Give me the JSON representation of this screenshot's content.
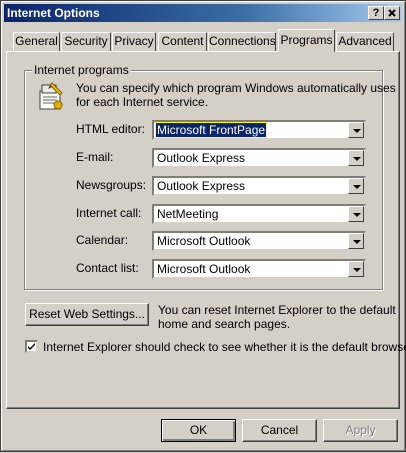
{
  "window": {
    "title": "Internet Options",
    "help_button": "?",
    "close_button": "X"
  },
  "tabs": [
    {
      "label": "General"
    },
    {
      "label": "Security"
    },
    {
      "label": "Privacy"
    },
    {
      "label": "Content"
    },
    {
      "label": "Connections"
    },
    {
      "label": "Programs",
      "active": true
    },
    {
      "label": "Advanced"
    }
  ],
  "programs": {
    "group_label": "Internet programs",
    "description_line1": "You can specify which program Windows automatically uses",
    "description_line2": "for each Internet service.",
    "icon": "programs-icon",
    "rows": [
      {
        "label": "HTML editor:",
        "value": "Microsoft FrontPage"
      },
      {
        "label": "E-mail:",
        "value": "Outlook Express"
      },
      {
        "label": "Newsgroups:",
        "value": "Outlook Express"
      },
      {
        "label": "Internet call:",
        "value": "NetMeeting"
      },
      {
        "label": "Calendar:",
        "value": "Microsoft Outlook"
      },
      {
        "label": "Contact list:",
        "value": "Microsoft Outlook"
      }
    ]
  },
  "reset": {
    "button_label": "Reset Web Settings...",
    "description_line1": "You can reset Internet Explorer to the default",
    "description_line2": "home and search pages."
  },
  "default_check": {
    "label": "Internet Explorer should check to see whether it is the default browser",
    "checked": true
  },
  "footer": {
    "ok": "OK",
    "cancel": "Cancel",
    "apply": "Apply"
  },
  "colors": {
    "titlebar_start": "#0a246a",
    "titlebar_end": "#a6caf0",
    "face": "#d4d0c8",
    "selection": "#0a246a"
  }
}
